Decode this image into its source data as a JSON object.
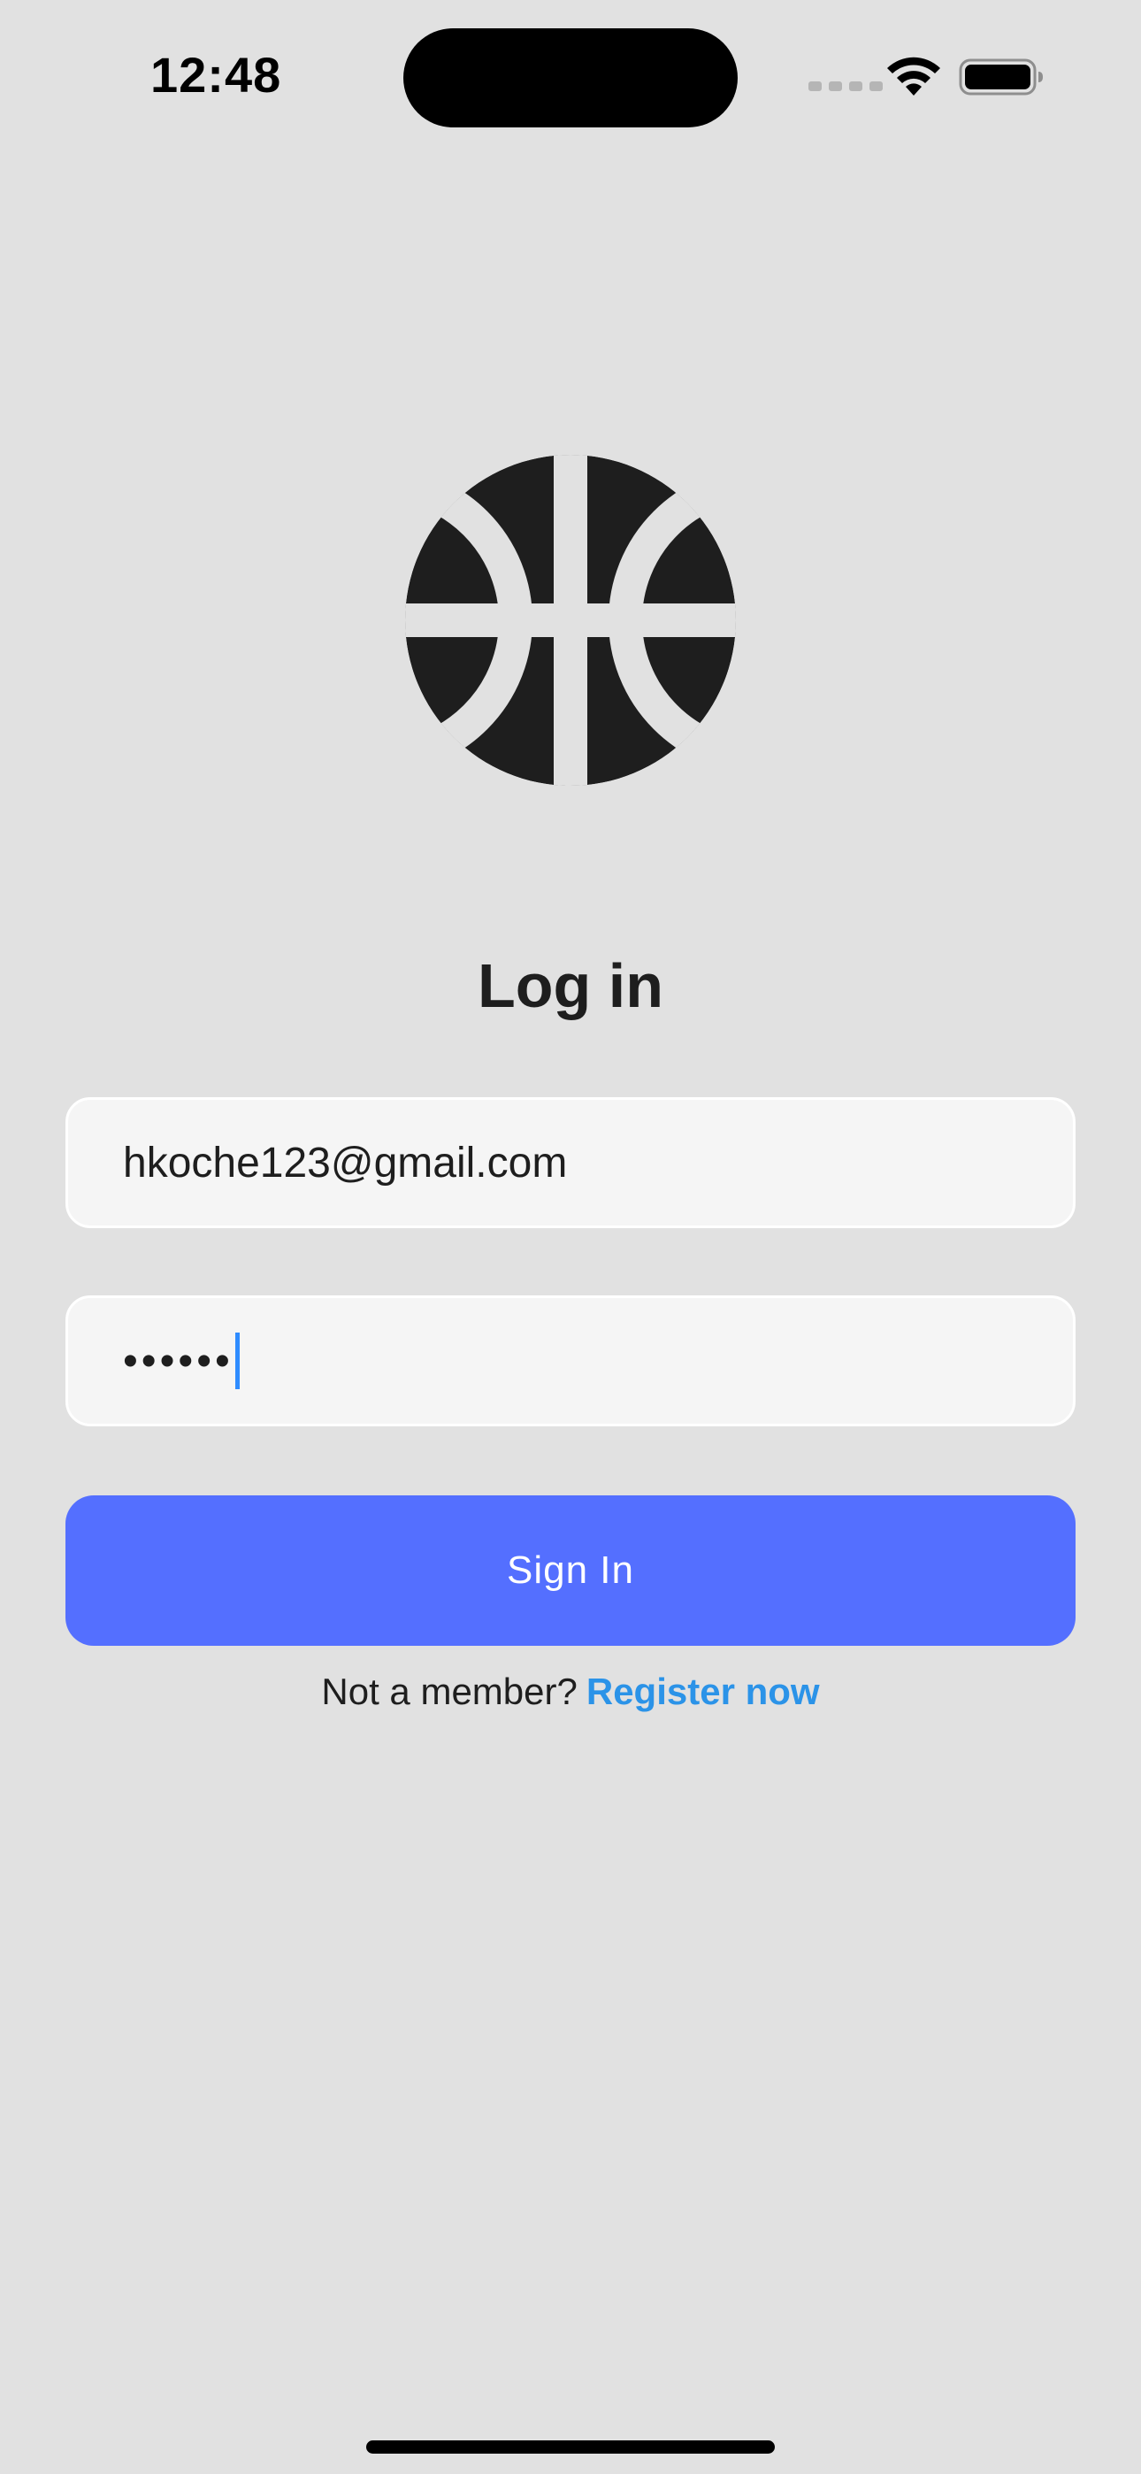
{
  "status_bar": {
    "time": "12:48",
    "signal_icon": "cellular-signal-icon",
    "wifi_icon": "wifi-icon",
    "battery_icon": "battery-icon"
  },
  "logo": {
    "icon": "basketball-icon",
    "color": "#1e1e1e"
  },
  "login": {
    "title": "Log in",
    "email_value": "hkoche123@gmail.com",
    "password_value": "••••••",
    "sign_in_label": "Sign In",
    "register_prompt": "Not a member?",
    "register_link": "Register now"
  },
  "colors": {
    "background": "#e1e1e1",
    "accent": "#546fff",
    "link": "#2b93e8"
  }
}
